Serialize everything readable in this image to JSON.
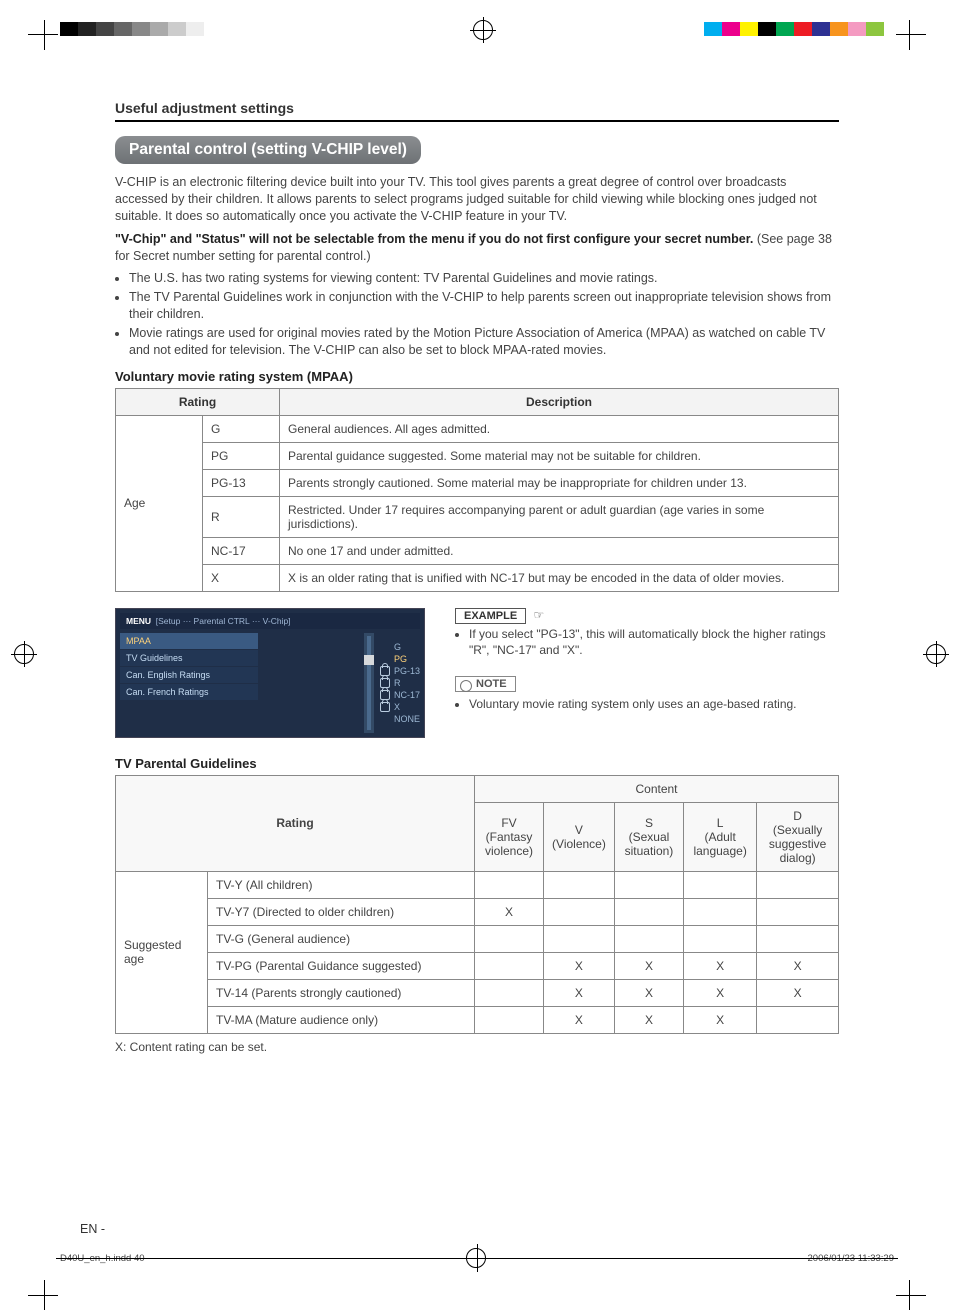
{
  "header": {
    "section_title": "Useful adjustment settings",
    "pill": "Parental control (setting V-CHIP level)"
  },
  "intro": {
    "para": "V-CHIP is an electronic filtering device built into your TV. This tool gives parents a great degree of control over broadcasts accessed by their children. It allows parents to select programs judged suitable for child viewing while blocking ones judged not suitable. It does so automatically once you activate the V-CHIP feature in your TV.",
    "bold_line": "\"V-Chip\" and \"Status\" will not be selectable from the menu if you do not first configure your secret number.",
    "bold_tail": " (See page 38 for Secret number setting for parental control.)"
  },
  "bullets": [
    "The U.S. has two rating systems for viewing content: TV Parental Guidelines and movie ratings.",
    "The TV Parental Guidelines work in conjunction with the V-CHIP to help parents screen out inappropriate television shows from their children.",
    "Movie ratings are used for original movies rated by the Motion Picture Association of America (MPAA) as watched on cable TV and not edited for television. The V-CHIP can also be set to block MPAA-rated movies."
  ],
  "mpaa": {
    "heading": "Voluntary movie rating system (MPAA)",
    "col_rating": "Rating",
    "col_desc": "Description",
    "rowgroup_label": "Age",
    "rows": [
      {
        "rating": "G",
        "desc": "General audiences. All ages admitted."
      },
      {
        "rating": "PG",
        "desc": "Parental guidance suggested. Some material may not be suitable for children."
      },
      {
        "rating": "PG-13",
        "desc": "Parents strongly cautioned. Some material may be inappropriate for children under 13."
      },
      {
        "rating": "R",
        "desc": "Restricted. Under 17 requires accompanying parent or adult guardian (age varies in some jurisdictions)."
      },
      {
        "rating": "NC-17",
        "desc": "No one 17 and under admitted."
      },
      {
        "rating": "X",
        "desc": "X is an older rating that is unified with NC-17 but may be encoded in the data of older movies."
      }
    ]
  },
  "osd": {
    "menu_label": "MENU",
    "breadcrumb": "[Setup ··· Parental CTRL ··· V-Chip]",
    "left_items": [
      "MPAA",
      "TV Guidelines",
      "Can. English Ratings",
      "Can. French Ratings"
    ],
    "right_items": [
      {
        "label": "G",
        "lock": false
      },
      {
        "label": "PG",
        "lock": false,
        "hi": true
      },
      {
        "label": "PG-13",
        "lock": true
      },
      {
        "label": "R",
        "lock": true
      },
      {
        "label": "NC-17",
        "lock": true
      },
      {
        "label": "X",
        "lock": true
      },
      {
        "label": "NONE",
        "lock": false
      }
    ]
  },
  "example": {
    "tag": "EXAMPLE",
    "text": "If you select \"PG-13\", this will automatically block the higher ratings \"R\", \"NC-17\" and \"X\"."
  },
  "note": {
    "tag": "NOTE",
    "text": "Voluntary movie rating system only uses an age-based rating."
  },
  "tvpg": {
    "heading": "TV Parental Guidelines",
    "col_rating": "Rating",
    "col_content": "Content",
    "cols": [
      {
        "code": "FV",
        "full": "(Fantasy violence)"
      },
      {
        "code": "V",
        "full": "(Violence)"
      },
      {
        "code": "S",
        "full": "(Sexual situation)"
      },
      {
        "code": "L",
        "full": "(Adult language)"
      },
      {
        "code": "D",
        "full": "(Sexually suggestive dialog)"
      }
    ],
    "rowgroup_label": "Suggested age",
    "rows": [
      {
        "label": "TV-Y (All children)",
        "marks": [
          "",
          "",
          "",
          "",
          ""
        ]
      },
      {
        "label": "TV-Y7 (Directed to older children)",
        "marks": [
          "X",
          "",
          "",
          "",
          ""
        ]
      },
      {
        "label": "TV-G (General audience)",
        "marks": [
          "",
          "",
          "",
          "",
          ""
        ]
      },
      {
        "label": "TV-PG (Parental Guidance suggested)",
        "marks": [
          "",
          "X",
          "X",
          "X",
          "X"
        ]
      },
      {
        "label": "TV-14 (Parents strongly cautioned)",
        "marks": [
          "",
          "X",
          "X",
          "X",
          "X"
        ]
      },
      {
        "label": "TV-MA (Mature audience only)",
        "marks": [
          "",
          "X",
          "X",
          "X",
          ""
        ]
      }
    ],
    "footnote": "X: Content rating can be set."
  },
  "footer": {
    "lang_badge": "EN",
    "file": "D40U_en_h.indd   40",
    "timestamp": "2006/01/23   11:33:29"
  },
  "swatches_left": [
    "#000",
    "#222",
    "#444",
    "#666",
    "#888",
    "#aaa",
    "#ccc",
    "#eee",
    "#fff"
  ],
  "swatches_right": [
    "#00aeef",
    "#ec008c",
    "#fff200",
    "#000",
    "#00a651",
    "#ed1c24",
    "#2e3192",
    "#f7941e",
    "#f49ac1",
    "#8dc63f"
  ]
}
